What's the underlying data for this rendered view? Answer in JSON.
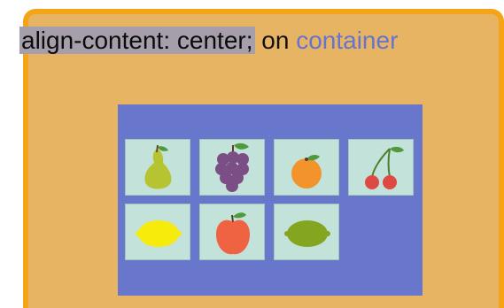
{
  "caption": {
    "code": "align-content: center;",
    "on": "on",
    "target": "container"
  },
  "items": [
    {
      "icon": "pear-icon"
    },
    {
      "icon": "grapes-icon"
    },
    {
      "icon": "orange-icon"
    },
    {
      "icon": "cherries-icon"
    },
    {
      "icon": "lemon-icon"
    },
    {
      "icon": "apple-icon"
    },
    {
      "icon": "lime-icon"
    }
  ],
  "colors": {
    "frame_background": "#e6b462",
    "frame_border": "#f5a417",
    "container_background": "#6877cc",
    "item_background": "#c3e3da",
    "code_highlight": "#a69fab",
    "target_text": "#6773ce"
  }
}
